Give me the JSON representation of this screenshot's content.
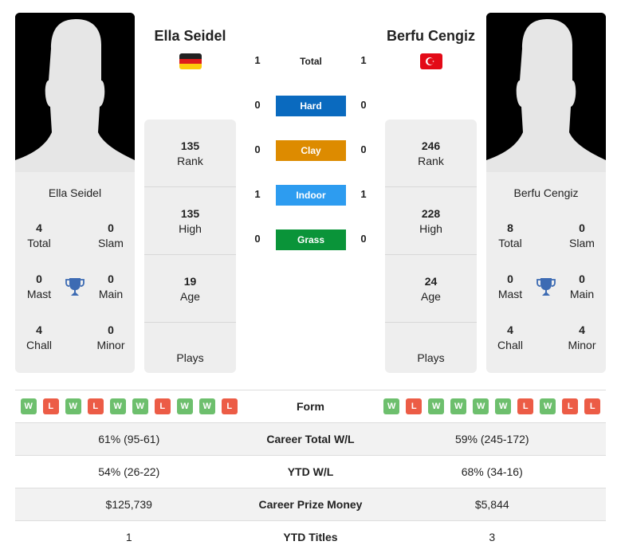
{
  "colors": {
    "hard": "#0a6abf",
    "clay": "#dd8b00",
    "indoor": "#2d9cf0",
    "grass": "#0a9439",
    "win": "#6dbf6d",
    "loss": "#ec5c46",
    "trophy": "#3d6bb3"
  },
  "player1": {
    "name": "Ella Seidel",
    "flag": "germany-flag",
    "card_name": "Ella Seidel",
    "titles": {
      "total": "4",
      "slam": "0",
      "mast": "0",
      "main": "0",
      "chall": "4",
      "minor": "0"
    },
    "labels": {
      "total": "Total",
      "slam": "Slam",
      "mast": "Mast",
      "main": "Main",
      "chall": "Chall",
      "minor": "Minor"
    },
    "rank": "135",
    "high": "135",
    "age": "19",
    "plays": ""
  },
  "player2": {
    "name": "Berfu Cengiz",
    "flag": "turkey-flag",
    "card_name": "Berfu Cengiz",
    "titles": {
      "total": "8",
      "slam": "0",
      "mast": "0",
      "main": "0",
      "chall": "4",
      "minor": "4"
    },
    "labels": {
      "total": "Total",
      "slam": "Slam",
      "mast": "Mast",
      "main": "Main",
      "chall": "Chall",
      "minor": "Minor"
    },
    "rank": "246",
    "high": "228",
    "age": "24",
    "plays": ""
  },
  "side_labels": {
    "rank": "Rank",
    "high": "High",
    "age": "Age",
    "plays": "Plays"
  },
  "h2h": {
    "total": {
      "label": "Total",
      "p1": "1",
      "p2": "1"
    },
    "surfaces": [
      {
        "label": "Hard",
        "p1": "0",
        "p2": "0"
      },
      {
        "label": "Clay",
        "p1": "0",
        "p2": "0"
      },
      {
        "label": "Indoor",
        "p1": "1",
        "p2": "1"
      },
      {
        "label": "Grass",
        "p1": "0",
        "p2": "0"
      }
    ]
  },
  "comparison": {
    "form": {
      "label": "Form",
      "p1": [
        "W",
        "L",
        "W",
        "L",
        "W",
        "W",
        "L",
        "W",
        "W",
        "L"
      ],
      "p2": [
        "W",
        "L",
        "W",
        "W",
        "W",
        "W",
        "L",
        "W",
        "L",
        "L"
      ]
    },
    "rows": [
      {
        "label": "Career Total W/L",
        "p1": "61% (95-61)",
        "p2": "59% (245-172)"
      },
      {
        "label": "YTD W/L",
        "p1": "54% (26-22)",
        "p2": "68% (34-16)"
      },
      {
        "label": "Career Prize Money",
        "p1": "$125,739",
        "p2": "$5,844"
      },
      {
        "label": "YTD Titles",
        "p1": "1",
        "p2": "3"
      }
    ]
  }
}
